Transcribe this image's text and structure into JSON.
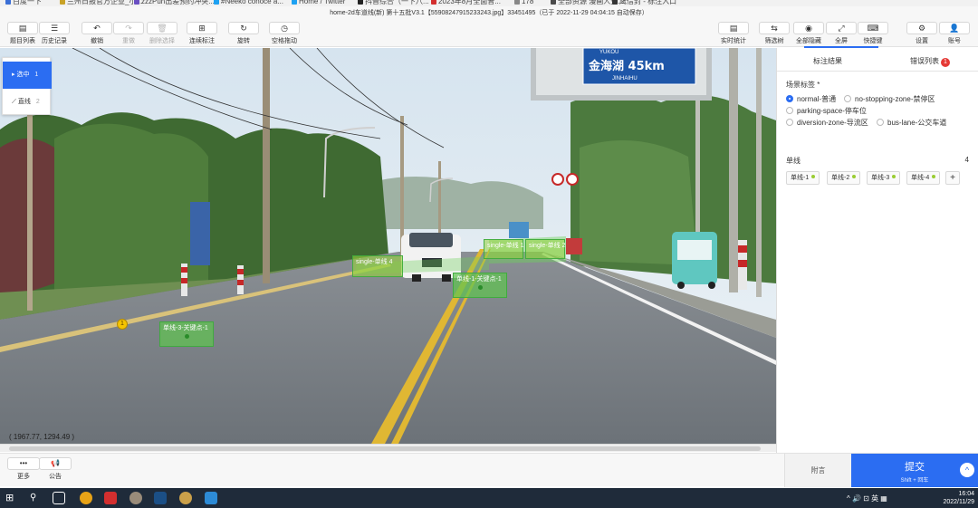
{
  "bookmarks": [
    {
      "label": "百度一下",
      "color": "#3b6fd6"
    },
    {
      "label": "兰州日报官方企业_小...",
      "color": "#c9a227"
    },
    {
      "label": "zzzPun出差预约冲突...",
      "color": "#6a4fc2"
    },
    {
      "label": "#Neeko conoce a...",
      "color": "#1da1f2"
    },
    {
      "label": "Home / Twitter",
      "color": "#1da1f2"
    },
    {
      "label": "抖音综合（一下八...",
      "color": "#222222"
    },
    {
      "label": "2023年8月全面普...",
      "color": "#d32f2f"
    },
    {
      "label": "178",
      "color": "#888888"
    },
    {
      "label": "全部资源 漫画人生...",
      "color": "#4a4a4a"
    },
    {
      "label": "鹰信封 - 标注入口",
      "color": "#333333"
    }
  ],
  "app": {
    "title": "home-2d车道线(新) 第十五批V3.1【55908247915233243.jpg】33451495（已于 2022-11-29 04:04:15 自动保存）"
  },
  "toolbar_left": [
    {
      "icon": "▤",
      "label": "题目列表",
      "enabled": true
    },
    {
      "icon": "☰",
      "label": "历史记录",
      "enabled": true
    },
    {
      "icon": "↶",
      "label": "撤销",
      "enabled": true
    },
    {
      "icon": "↷",
      "label": "重做",
      "enabled": false
    },
    {
      "icon": "🗑",
      "label": "删除选择",
      "enabled": false
    },
    {
      "icon": "⊞",
      "label": "连续标注",
      "enabled": true
    },
    {
      "icon": "↻",
      "label": "旋转",
      "enabled": true
    },
    {
      "icon": "◷",
      "label": "空格拖动",
      "enabled": true
    }
  ],
  "toolbar_right": [
    {
      "icon": "▤",
      "label": "实时统计"
    },
    {
      "icon": "⇆",
      "label": "筛选树"
    },
    {
      "icon": "◉",
      "label": "全部隐藏"
    },
    {
      "icon": "⤢",
      "label": "全屏"
    },
    {
      "icon": "⌨",
      "label": "快捷键"
    },
    {
      "icon": "⚙",
      "label": "设置"
    },
    {
      "icon": "👤",
      "label": "账号"
    }
  ],
  "tools": [
    {
      "label": "选中",
      "count": "1",
      "active": true
    },
    {
      "label": "直线",
      "count": "2",
      "active": false
    }
  ],
  "canvas": {
    "coordinate": "( 1967.77, 1294.49 )",
    "sign_text": "金海湖 45km",
    "sign_top": "YUKOU",
    "sign_bottom": "JINHAIHU",
    "marker": "1",
    "labels": [
      {
        "text": "单线-3-关键点-1"
      },
      {
        "text": "单线-1-关键点-1"
      },
      {
        "text": "single-单线 4"
      },
      {
        "text": "single-单线 2"
      },
      {
        "text": "single-单线 1"
      },
      {
        "text": "single-单线 2"
      }
    ]
  },
  "right_panel": {
    "tab_annotation": "标注结果",
    "tab_errors": "错误列表",
    "error_count": "1",
    "scene_title": "场景标签 *",
    "scene_options": [
      {
        "label": "normal-普通",
        "checked": true
      },
      {
        "label": "no-stopping-zone-禁停区",
        "checked": false
      },
      {
        "label": "parking-space-停车位",
        "checked": false
      },
      {
        "label": "diversion-zone-导流区",
        "checked": false
      },
      {
        "label": "bus-lane-公交车道",
        "checked": false
      }
    ],
    "lines_title": "单线",
    "lines_count": "4",
    "lines": [
      "单线-1",
      "单线-2",
      "单线-3",
      "单线-4"
    ],
    "add": "+"
  },
  "bottom": {
    "more_label": "更多",
    "more_icon": "•••",
    "notice_label": "公告",
    "notice_icon": "📢",
    "note_label": "附言",
    "submit_label": "提交",
    "submit_hint": "Shift + 回车",
    "up_icon": "^"
  },
  "taskbar": {
    "time": "16:04",
    "date": "2022/11/29",
    "ime": "英",
    "tray": "^ 🔊 ⊡ 英 ▦"
  }
}
